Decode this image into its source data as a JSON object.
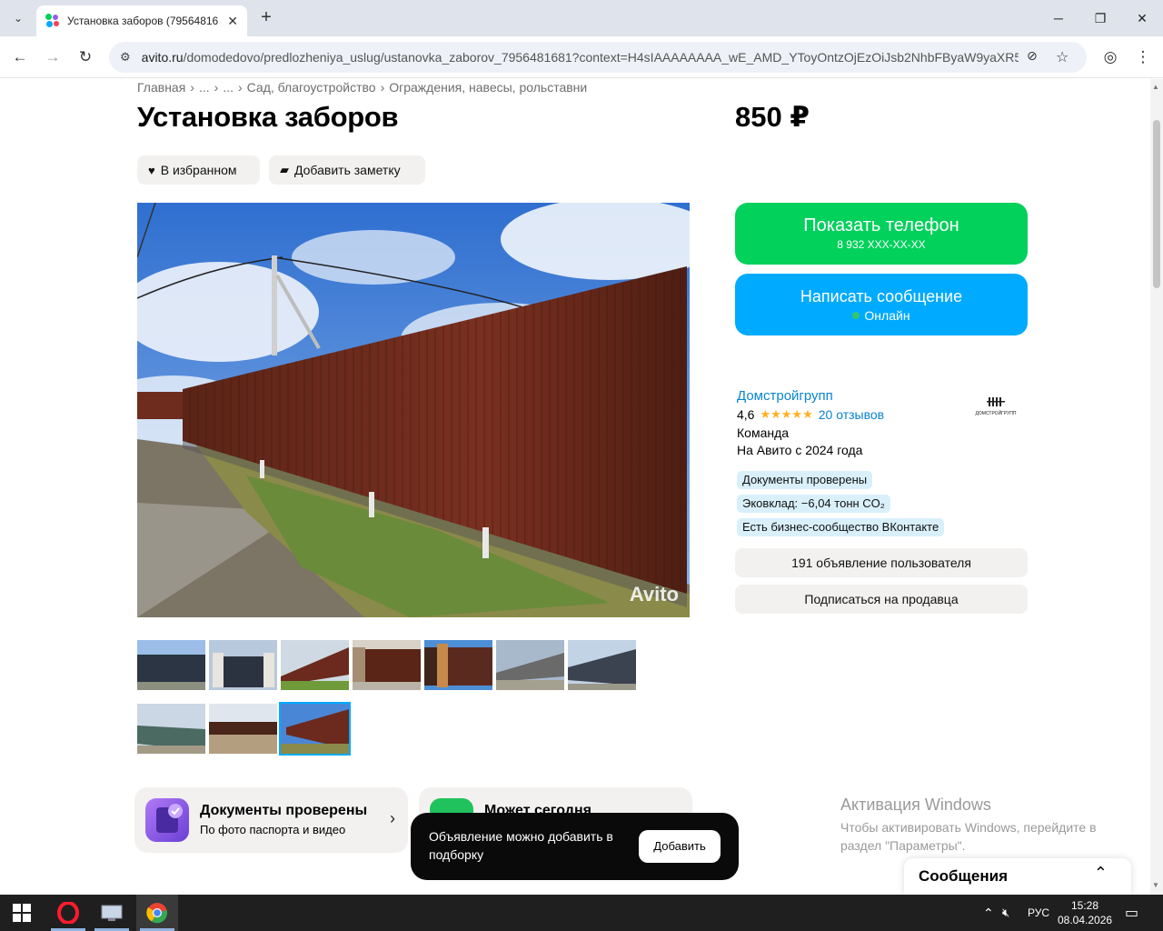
{
  "browser": {
    "tab_title": "Установка заборов (79564816",
    "url_host": "avito.ru",
    "url_path": "/domodedovo/predlozheniya_uslug/ustanovka_zaborov_7956481681?context=H4sIAAAAAAAA_wE_AMD_YToyOntzOjEzOiJsb2NhbFByaW9yaXR5Ijt..."
  },
  "breadcrumb": [
    "Главная",
    "›",
    "...",
    "›",
    "...",
    "›",
    "Сад, благоустройство",
    "›",
    "Ограждения, навесы, рольставни"
  ],
  "listing": {
    "title": "Установка заборов",
    "price": "850 ₽",
    "fav_label": "В избранном",
    "note_label": "Добавить заметку",
    "watermark": "Avito"
  },
  "contact": {
    "phone_label": "Показать телефон",
    "phone_masked": "8 932 XXX-XX-XX",
    "message_label": "Написать сообщение",
    "online_label": "Онлайн"
  },
  "seller": {
    "name": "Домстройгрупп",
    "rating": "4,6",
    "stars": "★★★★★",
    "reviews": "20 отзывов",
    "type": "Команда",
    "since": "На Авито с 2024 года",
    "logo_text": "ДОМСТРОЙГРУПП",
    "badges": [
      "Документы проверены",
      "Эковклад: −6,04 тонн CO₂",
      "Есть бизнес-сообщество ВКонтакте"
    ],
    "listings_button": "191 объявление пользователя",
    "subscribe_button": "Подписаться на продавца"
  },
  "cards": {
    "docs_title": "Документы проверены",
    "docs_sub": "По фото паспорта и видео",
    "second_title": "Может сегодня"
  },
  "toast": {
    "text": "Объявление можно добавить в подборку",
    "button": "Добавить"
  },
  "windows": {
    "activation_title": "Активация Windows",
    "activation_text": "Чтобы активировать Windows, перейдите в раздел \"Параметры\"."
  },
  "messages_panel": {
    "title": "Сообщения"
  },
  "taskbar": {
    "lang": "РУС",
    "time": "15:28",
    "date": "08.04.2026"
  },
  "colors": {
    "green": "#02d15c",
    "blue": "#00aaff",
    "link": "#0a85d0",
    "fence": "#6b2a1d"
  }
}
